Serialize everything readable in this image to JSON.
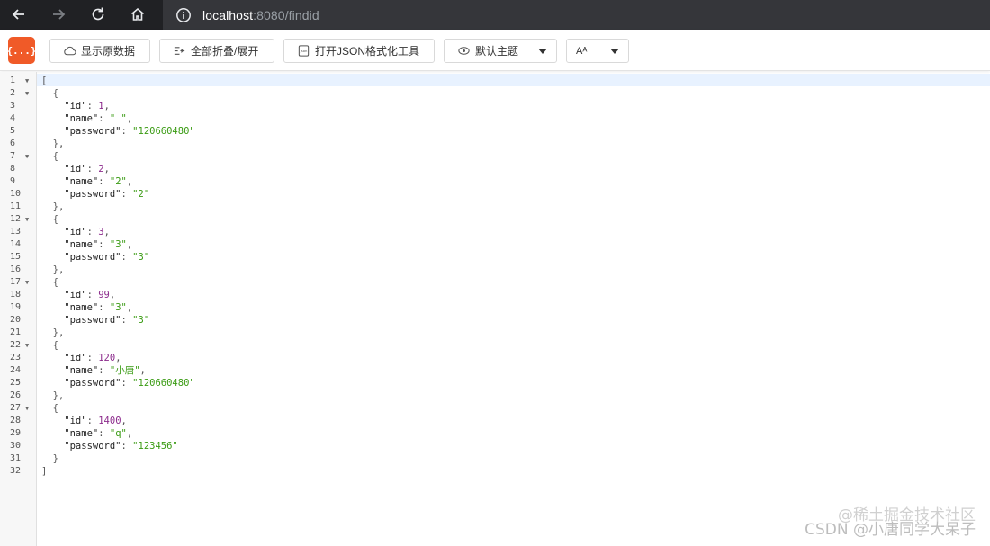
{
  "browser": {
    "url_host": "localhost",
    "url_path": ":8080/findid"
  },
  "toolbar": {
    "logo_text": "{...}",
    "raw_label": "显示原数据",
    "fold_label": "全部折叠/展开",
    "json_tool_label": "打开JSON格式化工具",
    "theme_label": "默认主题",
    "font_label": "Aᴬ"
  },
  "editor": {
    "lines": [
      [
        {
          "t": "p",
          "v": "["
        }
      ],
      [
        {
          "t": "p",
          "v": "  {"
        }
      ],
      [
        {
          "t": "k",
          "v": "    \"id\""
        },
        {
          "t": "p",
          "v": ": "
        },
        {
          "t": "n",
          "v": "1"
        },
        {
          "t": "p",
          "v": ","
        }
      ],
      [
        {
          "t": "k",
          "v": "    \"name\""
        },
        {
          "t": "p",
          "v": ": "
        },
        {
          "t": "s",
          "v": "\" \""
        },
        {
          "t": "p",
          "v": ","
        }
      ],
      [
        {
          "t": "k",
          "v": "    \"password\""
        },
        {
          "t": "p",
          "v": ": "
        },
        {
          "t": "s",
          "v": "\"120660480\""
        }
      ],
      [
        {
          "t": "p",
          "v": "  },"
        }
      ],
      [
        {
          "t": "p",
          "v": "  {"
        }
      ],
      [
        {
          "t": "k",
          "v": "    \"id\""
        },
        {
          "t": "p",
          "v": ": "
        },
        {
          "t": "n",
          "v": "2"
        },
        {
          "t": "p",
          "v": ","
        }
      ],
      [
        {
          "t": "k",
          "v": "    \"name\""
        },
        {
          "t": "p",
          "v": ": "
        },
        {
          "t": "s",
          "v": "\"2\""
        },
        {
          "t": "p",
          "v": ","
        }
      ],
      [
        {
          "t": "k",
          "v": "    \"password\""
        },
        {
          "t": "p",
          "v": ": "
        },
        {
          "t": "s",
          "v": "\"2\""
        }
      ],
      [
        {
          "t": "p",
          "v": "  },"
        }
      ],
      [
        {
          "t": "p",
          "v": "  {"
        }
      ],
      [
        {
          "t": "k",
          "v": "    \"id\""
        },
        {
          "t": "p",
          "v": ": "
        },
        {
          "t": "n",
          "v": "3"
        },
        {
          "t": "p",
          "v": ","
        }
      ],
      [
        {
          "t": "k",
          "v": "    \"name\""
        },
        {
          "t": "p",
          "v": ": "
        },
        {
          "t": "s",
          "v": "\"3\""
        },
        {
          "t": "p",
          "v": ","
        }
      ],
      [
        {
          "t": "k",
          "v": "    \"password\""
        },
        {
          "t": "p",
          "v": ": "
        },
        {
          "t": "s",
          "v": "\"3\""
        }
      ],
      [
        {
          "t": "p",
          "v": "  },"
        }
      ],
      [
        {
          "t": "p",
          "v": "  {"
        }
      ],
      [
        {
          "t": "k",
          "v": "    \"id\""
        },
        {
          "t": "p",
          "v": ": "
        },
        {
          "t": "n",
          "v": "99"
        },
        {
          "t": "p",
          "v": ","
        }
      ],
      [
        {
          "t": "k",
          "v": "    \"name\""
        },
        {
          "t": "p",
          "v": ": "
        },
        {
          "t": "s",
          "v": "\"3\""
        },
        {
          "t": "p",
          "v": ","
        }
      ],
      [
        {
          "t": "k",
          "v": "    \"password\""
        },
        {
          "t": "p",
          "v": ": "
        },
        {
          "t": "s",
          "v": "\"3\""
        }
      ],
      [
        {
          "t": "p",
          "v": "  },"
        }
      ],
      [
        {
          "t": "p",
          "v": "  {"
        }
      ],
      [
        {
          "t": "k",
          "v": "    \"id\""
        },
        {
          "t": "p",
          "v": ": "
        },
        {
          "t": "n",
          "v": "120"
        },
        {
          "t": "p",
          "v": ","
        }
      ],
      [
        {
          "t": "k",
          "v": "    \"name\""
        },
        {
          "t": "p",
          "v": ": "
        },
        {
          "t": "s",
          "v": "\"小唐\""
        },
        {
          "t": "p",
          "v": ","
        }
      ],
      [
        {
          "t": "k",
          "v": "    \"password\""
        },
        {
          "t": "p",
          "v": ": "
        },
        {
          "t": "s",
          "v": "\"120660480\""
        }
      ],
      [
        {
          "t": "p",
          "v": "  },"
        }
      ],
      [
        {
          "t": "p",
          "v": "  {"
        }
      ],
      [
        {
          "t": "k",
          "v": "    \"id\""
        },
        {
          "t": "p",
          "v": ": "
        },
        {
          "t": "n",
          "v": "1400"
        },
        {
          "t": "p",
          "v": ","
        }
      ],
      [
        {
          "t": "k",
          "v": "    \"name\""
        },
        {
          "t": "p",
          "v": ": "
        },
        {
          "t": "s",
          "v": "\"q\""
        },
        {
          "t": "p",
          "v": ","
        }
      ],
      [
        {
          "t": "k",
          "v": "    \"password\""
        },
        {
          "t": "p",
          "v": ": "
        },
        {
          "t": "s",
          "v": "\"123456\""
        }
      ],
      [
        {
          "t": "p",
          "v": "  }"
        }
      ],
      [
        {
          "t": "p",
          "v": "]"
        }
      ]
    ],
    "fold_lines": [
      1,
      2,
      7,
      12,
      17,
      22,
      27
    ]
  },
  "watermark": {
    "top": "@稀土掘金技术社区",
    "bottom": "CSDN @小唐同学大呆子"
  },
  "colors": {
    "accent": "#f05a28",
    "string": "#3a9b13",
    "number": "#8c2b8c"
  }
}
